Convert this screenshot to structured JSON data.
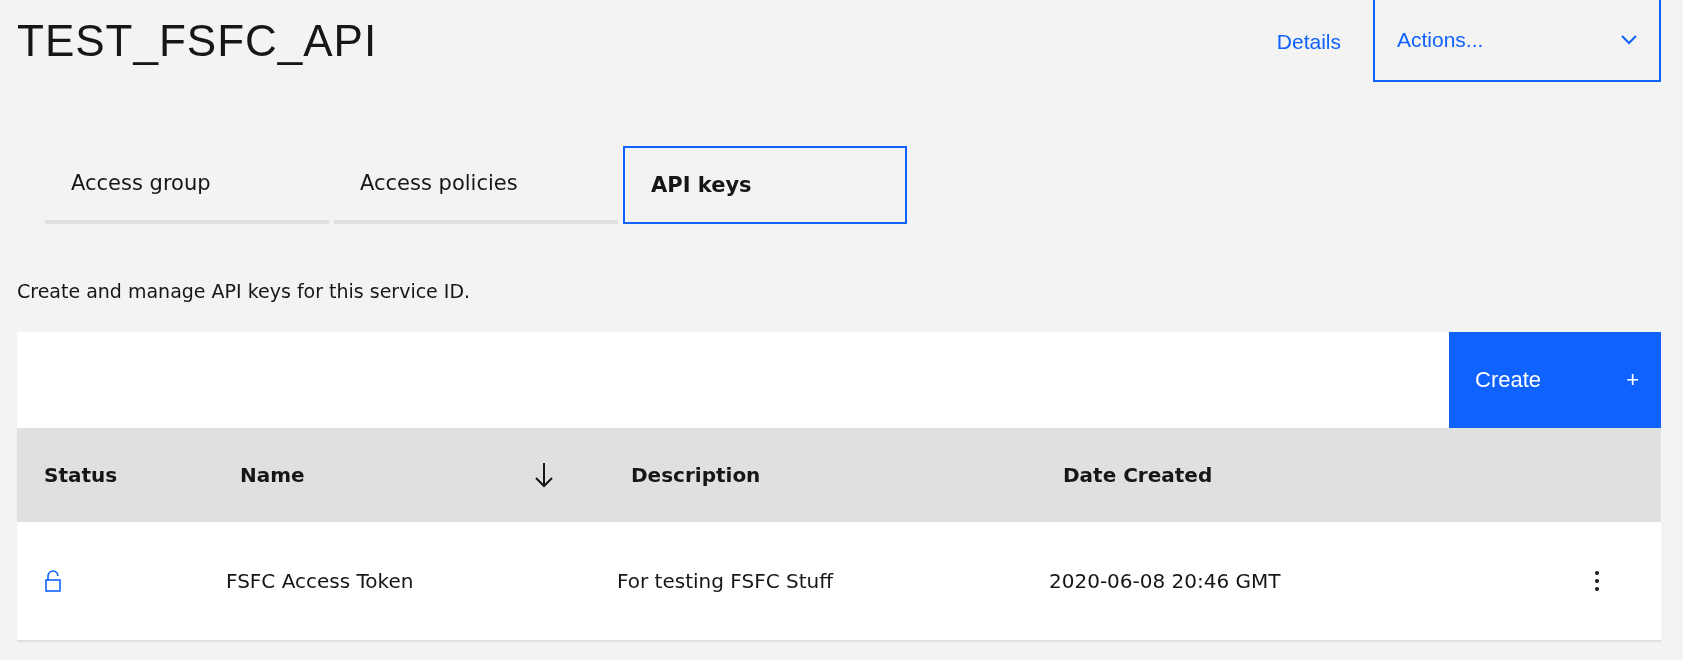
{
  "title": "TEST_FSFC_API",
  "header_actions": {
    "details_link": "Details",
    "actions_dropdown": "Actions..."
  },
  "tabs": [
    {
      "label": "Access group",
      "selected": false
    },
    {
      "label": "Access policies",
      "selected": false
    },
    {
      "label": "API keys",
      "selected": true
    }
  ],
  "description": "Create and manage API keys for this service ID.",
  "toolbar": {
    "create_button": "Create",
    "create_icon": "+"
  },
  "table": {
    "columns": [
      {
        "label": "Status",
        "sorted": false
      },
      {
        "label": "Name",
        "sorted": true
      },
      {
        "label": "Description",
        "sorted": false
      },
      {
        "label": "Date Created",
        "sorted": false
      }
    ],
    "rows": [
      {
        "locked": false,
        "name": "FSFC Access Token",
        "description": "For testing FSFC Stuff",
        "date_created": "2020-06-08 20:46 GMT"
      }
    ]
  }
}
